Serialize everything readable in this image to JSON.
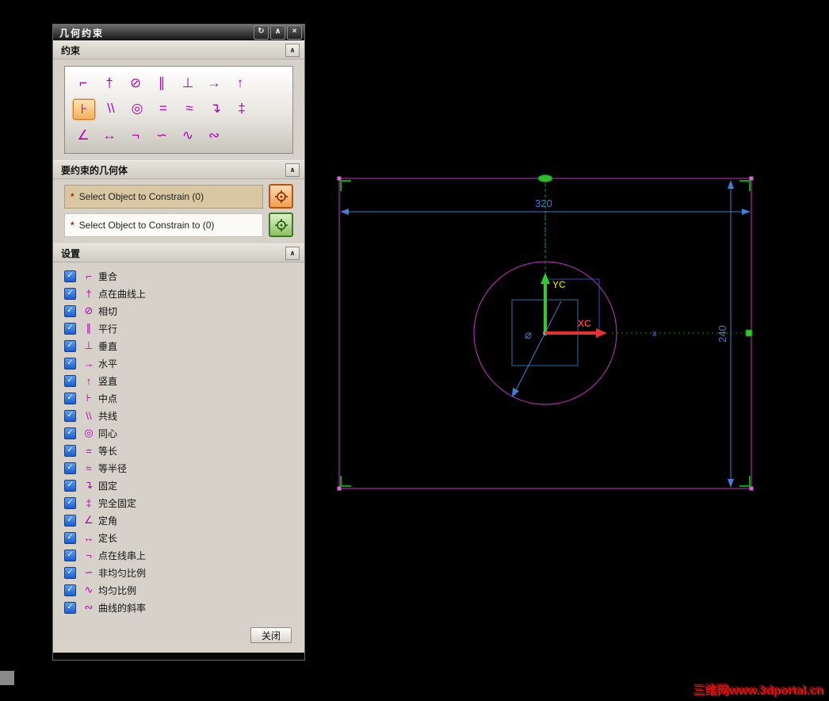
{
  "window": {
    "title": "几何约束",
    "buttons": {
      "reset": "↻",
      "collapse": "∧",
      "close": "×"
    }
  },
  "sections": {
    "constraints": {
      "label": "约束"
    },
    "geometry": {
      "label": "要约束的几何体"
    },
    "settings": {
      "label": "设置"
    }
  },
  "glyphs": {
    "chevron": "∧",
    "check": "✓"
  },
  "palette": {
    "rows": [
      [
        {
          "name": "coincident",
          "glyph": "⌐"
        },
        {
          "name": "point-on-curve",
          "glyph": "†"
        },
        {
          "name": "tangent",
          "glyph": "⊘"
        },
        {
          "name": "parallel",
          "glyph": "∥"
        },
        {
          "name": "perpendicular",
          "glyph": "⊥"
        },
        {
          "name": "horizontal",
          "glyph": "→"
        },
        {
          "name": "vertical",
          "glyph": "↑"
        }
      ],
      [
        {
          "name": "midpoint",
          "glyph": "⊦",
          "selected": true
        },
        {
          "name": "collinear",
          "glyph": "\\\\"
        },
        {
          "name": "concentric",
          "glyph": "◎"
        },
        {
          "name": "equal-length",
          "glyph": "="
        },
        {
          "name": "equal-radius",
          "glyph": "≈"
        },
        {
          "name": "fixed",
          "glyph": "↴"
        },
        {
          "name": "fully-fixed",
          "glyph": "‡"
        }
      ],
      [
        {
          "name": "angle",
          "glyph": "∠"
        },
        {
          "name": "length",
          "glyph": "↔"
        },
        {
          "name": "point-on-string",
          "glyph": "¬"
        },
        {
          "name": "non-uniform-scale",
          "glyph": "∽"
        },
        {
          "name": "uniform-scale",
          "glyph": "∿"
        },
        {
          "name": "curve-slope",
          "glyph": "∾"
        }
      ]
    ]
  },
  "geometry_select": {
    "rows": [
      {
        "star": "*",
        "label": "Select Object to Constrain (0)",
        "active": true
      },
      {
        "star": "*",
        "label": "Select Object to Constrain to (0)",
        "active": false
      }
    ]
  },
  "settings": {
    "items": [
      {
        "name": "coincident",
        "glyph": "⌐",
        "label": "重合",
        "checked": true
      },
      {
        "name": "point-on-curve",
        "glyph": "†",
        "label": "点在曲线上",
        "checked": true
      },
      {
        "name": "tangent",
        "glyph": "⊘",
        "label": "相切",
        "checked": true
      },
      {
        "name": "parallel",
        "glyph": "∥",
        "label": "平行",
        "checked": true
      },
      {
        "name": "perpendicular",
        "glyph": "⊥",
        "label": "垂直",
        "checked": true
      },
      {
        "name": "horizontal",
        "glyph": "→",
        "label": "水平",
        "checked": true
      },
      {
        "name": "vertical",
        "glyph": "↑",
        "label": "竖直",
        "checked": true
      },
      {
        "name": "midpoint",
        "glyph": "⊦",
        "label": "中点",
        "checked": true
      },
      {
        "name": "collinear",
        "glyph": "\\\\",
        "label": "共线",
        "checked": true
      },
      {
        "name": "concentric",
        "glyph": "◎",
        "label": "同心",
        "checked": true
      },
      {
        "name": "equal-length",
        "glyph": "=",
        "label": "等长",
        "checked": true
      },
      {
        "name": "equal-radius",
        "glyph": "≈",
        "label": "等半径",
        "checked": true
      },
      {
        "name": "fixed",
        "glyph": "↴",
        "label": "固定",
        "checked": true
      },
      {
        "name": "fully-fixed",
        "glyph": "‡",
        "label": "完全固定",
        "checked": true
      },
      {
        "name": "angle",
        "glyph": "∠",
        "label": "定角",
        "checked": true
      },
      {
        "name": "length",
        "glyph": "↔",
        "label": "定长",
        "checked": true
      },
      {
        "name": "point-on-string",
        "glyph": "¬",
        "label": "点在线串上",
        "checked": true
      },
      {
        "name": "non-uniform-scale",
        "glyph": "∽",
        "label": "非均匀比例",
        "checked": true
      },
      {
        "name": "uniform-scale",
        "glyph": "∿",
        "label": "均匀比例",
        "checked": true
      },
      {
        "name": "curve-slope",
        "glyph": "∾",
        "label": "曲线的斜率",
        "checked": true
      }
    ]
  },
  "footer": {
    "close_label": "关闭"
  },
  "sketch": {
    "width_dim": "320",
    "height_dim": "240",
    "x_axis_label": "XC",
    "y_axis_label": "YC",
    "diameter_symbol": "⌀",
    "point_marker": "x"
  },
  "colors": {
    "sketch_magenta": "#cc2fcc",
    "dimension_blue": "#3d7fd6",
    "axis_x_red": "#e83030",
    "axis_y_green": "#2ecc2e",
    "constraint_green": "#00a000",
    "checkbox_blue": "#1b5fd0",
    "selected_constraint_orange": "#d07820"
  },
  "watermark": "三维网www.3dportal.cn"
}
